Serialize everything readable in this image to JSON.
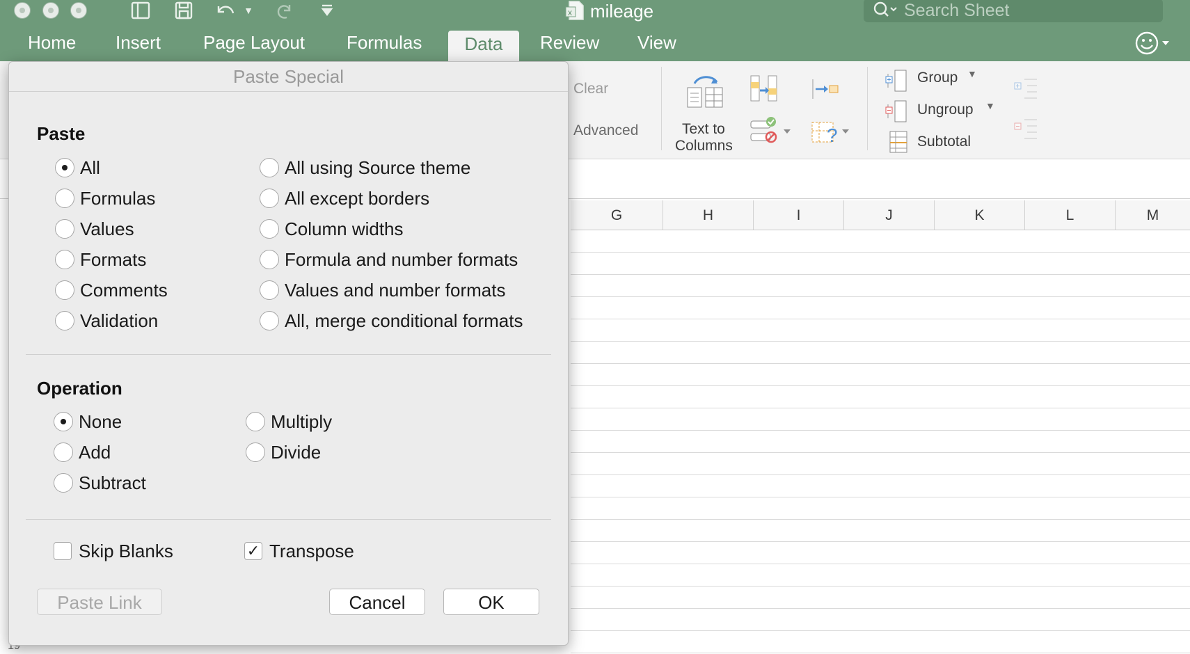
{
  "window": {
    "document_title": "mileage",
    "search": {
      "placeholder": "Search Sheet"
    }
  },
  "ribbon_tabs": [
    "Home",
    "Insert",
    "Page Layout",
    "Formulas",
    "Data",
    "Review",
    "View"
  ],
  "active_tab": "Data",
  "ribbon": {
    "clear_label": "Clear",
    "advanced_label": "Advanced",
    "text_to_columns_line1": "Text to",
    "text_to_columns_line2": "Columns",
    "group_label": "Group",
    "ungroup_label": "Ungroup",
    "subtotal_label": "Subtotal"
  },
  "sheet": {
    "column_headers": [
      "G",
      "H",
      "I",
      "J",
      "K",
      "L",
      "M"
    ],
    "row_number_partial": "19"
  },
  "dialog": {
    "title": "Paste Special",
    "paste_section_title": "Paste",
    "paste_options_left": [
      "All",
      "Formulas",
      "Values",
      "Formats",
      "Comments",
      "Validation"
    ],
    "paste_options_right": [
      "All using Source theme",
      "All except borders",
      "Column widths",
      "Formula and number formats",
      "Values and number formats",
      "All, merge conditional formats"
    ],
    "paste_selected": "All",
    "operation_section_title": "Operation",
    "operation_options_left": [
      "None",
      "Add",
      "Subtract"
    ],
    "operation_options_right": [
      "Multiply",
      "Divide"
    ],
    "operation_selected": "None",
    "skip_blanks_label": "Skip Blanks",
    "skip_blanks_checked": false,
    "transpose_label": "Transpose",
    "transpose_checked": true,
    "paste_link_label": "Paste Link",
    "cancel_label": "Cancel",
    "ok_label": "OK"
  },
  "colors": {
    "title_bar": "#6e9a7a",
    "ribbon_bg": "#f3f3f3",
    "dialog_bg": "#ececec"
  }
}
